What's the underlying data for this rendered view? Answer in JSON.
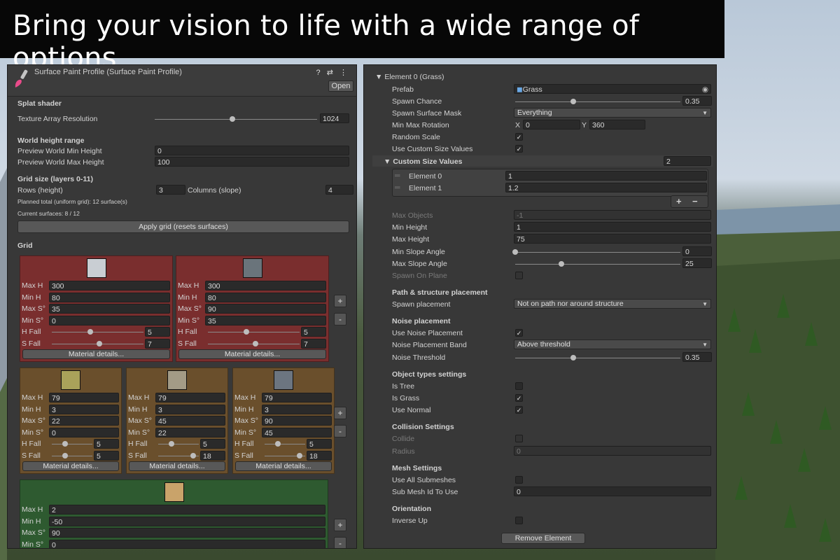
{
  "banner": {
    "headline": "Bring your vision to life with a wide range of options"
  },
  "left_panel": {
    "title": "Surface Paint Profile (Surface Paint Profile)",
    "header_icons": "? ⇄ ⋮",
    "open_label": "Open",
    "splat_shader": {
      "heading": "Splat shader",
      "texture_array_label": "Texture Array Resolution",
      "texture_array_value": "1024",
      "slider_level": 0.9
    },
    "world_height": {
      "heading": "World height range",
      "min_label": "Preview World Min Height",
      "min_value": "0",
      "max_label": "Preview World Max Height",
      "max_value": "100"
    },
    "grid_size": {
      "heading": "Grid size (layers 0-11)",
      "rows_label": "Rows (height)",
      "rows_value": "3",
      "columns_label": "Columns (slope)",
      "columns_value": "4",
      "planned_total": "Planned total (uniform grid): 12 surface(s)",
      "current_surfaces": "Current surfaces: 8 / 12",
      "apply_label": "Apply grid (resets surfaces)"
    },
    "grid_heading": "Grid",
    "field_labels": {
      "max_h": "Max H",
      "min_h": "Min H",
      "max_s": "Max S°",
      "min_s": "Min S°",
      "h_fall": "H Fall",
      "s_fall": "S Fall"
    },
    "material_details_label": "Material details...",
    "plus_label": "+",
    "minus_label": "-",
    "rows": [
      {
        "row_color": "#7a2e2e",
        "cells": [
          {
            "max_h": "300",
            "min_h": "80",
            "max_s": "35",
            "min_s": "0",
            "h_fall": "5",
            "s_fall": "7",
            "h_level": 0.42,
            "s_level": 0.52,
            "thumb_color": "#c9ced3"
          },
          {
            "max_h": "300",
            "min_h": "80",
            "max_s": "90",
            "min_s": "35",
            "h_fall": "5",
            "s_fall": "7",
            "h_level": 0.42,
            "s_level": 0.52,
            "thumb_color": "#6a747b"
          }
        ]
      },
      {
        "row_color": "#6a4f2c",
        "cells": [
          {
            "max_h": "79",
            "min_h": "3",
            "max_s": "22",
            "min_s": "0",
            "h_fall": "5",
            "s_fall": "5",
            "h_level": 0.32,
            "s_level": 0.32,
            "thumb_color": "#a9a25a"
          },
          {
            "max_h": "79",
            "min_h": "3",
            "max_s": "45",
            "min_s": "22",
            "h_fall": "5",
            "s_fall": "18",
            "h_level": 0.32,
            "s_level": 0.86,
            "thumb_color": "#a39b86"
          },
          {
            "max_h": "79",
            "min_h": "3",
            "max_s": "90",
            "min_s": "45",
            "h_fall": "5",
            "s_fall": "18",
            "h_level": 0.32,
            "s_level": 0.86,
            "thumb_color": "#6c7580"
          }
        ]
      },
      {
        "row_color": "#2e5a30",
        "cells": [
          {
            "max_h": "2",
            "min_h": "-50",
            "max_s": "90",
            "min_s": "0",
            "thumb_color": "#c9a36a"
          }
        ]
      }
    ]
  },
  "right_panel": {
    "element_header": "Element 0 (Grass)",
    "prefab_label": "Prefab",
    "prefab_value": "Grass",
    "spawn_chance_label": "Spawn Chance",
    "spawn_chance_value": "0.35",
    "spawn_chance_level": 0.35,
    "spawn_mask_label": "Spawn Surface Mask",
    "spawn_mask_value": "Everything",
    "rotation_label": "Min Max Rotation",
    "rotation_x_label": "X",
    "rotation_x_value": "0",
    "rotation_y_label": "Y",
    "rotation_y_value": "360",
    "random_scale_label": "Random Scale",
    "custom_size_label": "Use Custom Size Values",
    "custom_size_header": "Custom Size Values",
    "custom_size_count": "2",
    "size_elements": [
      {
        "label": "Element 0",
        "value": "1"
      },
      {
        "label": "Element 1",
        "value": "1.2"
      }
    ],
    "plus_label": "+",
    "minus_label": "−",
    "max_objects_label": "Max Objects",
    "max_objects_value": "-1",
    "min_height_label": "Min Height",
    "min_height_value": "1",
    "max_height_label": "Max Height",
    "max_height_value": "75",
    "min_slope_label": "Min Slope Angle",
    "min_slope_value": "0",
    "min_slope_level": 0.0,
    "max_slope_label": "Max Slope Angle",
    "max_slope_value": "25",
    "max_slope_level": 0.28,
    "spawn_on_plane_label": "Spawn On Plane",
    "path_heading": "Path & structure placement",
    "spawn_placement_label": "Spawn placement",
    "spawn_placement_value": "Not on path nor around structure",
    "noise_heading": "Noise placement",
    "use_noise_label": "Use Noise Placement",
    "noise_band_label": "Noise Placement Band",
    "noise_band_value": "Above threshold",
    "noise_threshold_label": "Noise Threshold",
    "noise_threshold_value": "0.35",
    "noise_threshold_level": 0.35,
    "object_types_heading": "Object types settings",
    "is_tree_label": "Is Tree",
    "is_grass_label": "Is Grass",
    "use_normal_label": "Use Normal",
    "collision_heading": "Collision Settings",
    "collide_label": "Collide",
    "radius_label": "Radius",
    "radius_value": "0",
    "mesh_heading": "Mesh Settings",
    "use_all_submeshes_label": "Use All Submeshes",
    "sub_mesh_label": "Sub Mesh Id To Use",
    "sub_mesh_value": "0",
    "orientation_heading": "Orientation",
    "inverse_up_label": "Inverse Up",
    "remove_label": "Remove Element",
    "check_mark": "✓"
  }
}
